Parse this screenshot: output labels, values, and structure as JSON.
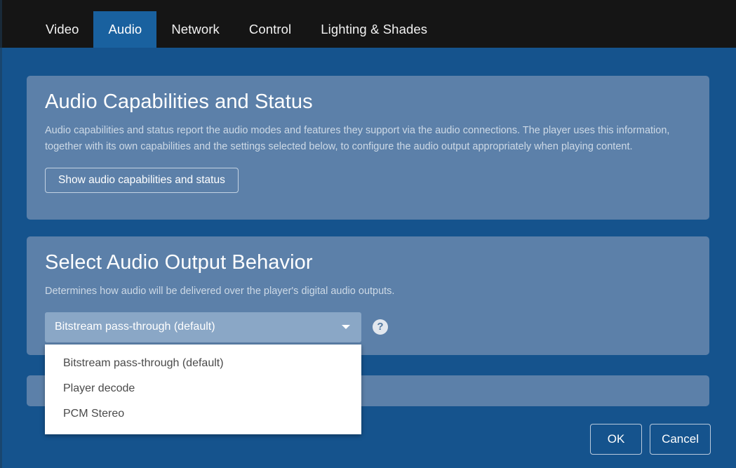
{
  "tabs": [
    {
      "label": "Video",
      "active": false
    },
    {
      "label": "Audio",
      "active": true
    },
    {
      "label": "Network",
      "active": false
    },
    {
      "label": "Control",
      "active": false
    },
    {
      "label": "Lighting & Shades",
      "active": false
    }
  ],
  "cards": {
    "capabilities": {
      "title": "Audio Capabilities and Status",
      "description": "Audio capabilities and status report the audio modes and features they support via the audio connections. The player uses this information, together with its own capabilities and the settings selected below, to configure the audio output appropriately when playing content.",
      "button_label": "Show audio capabilities and status"
    },
    "behavior": {
      "title": "Select Audio Output Behavior",
      "description": "Determines how audio will be delivered over the player's digital audio outputs.",
      "select": {
        "value": "Bitstream pass-through (default)",
        "options": [
          "Bitstream pass-through (default)",
          "Player decode",
          "PCM Stereo"
        ],
        "expanded": true
      },
      "help_icon": "question-mark-icon"
    }
  },
  "footer": {
    "ok_label": "OK",
    "cancel_label": "Cancel"
  },
  "colors": {
    "header_bar": "#151515",
    "page_background": "#15538d",
    "active_tab": "#19619f",
    "card_background": "#5c80a9",
    "select_background": "#8aa7c6",
    "dropdown_background": "#ffffff",
    "primary_text": "#ffffff",
    "muted_text": "#cdd9e6",
    "dropdown_text": "#4a4a4a"
  }
}
